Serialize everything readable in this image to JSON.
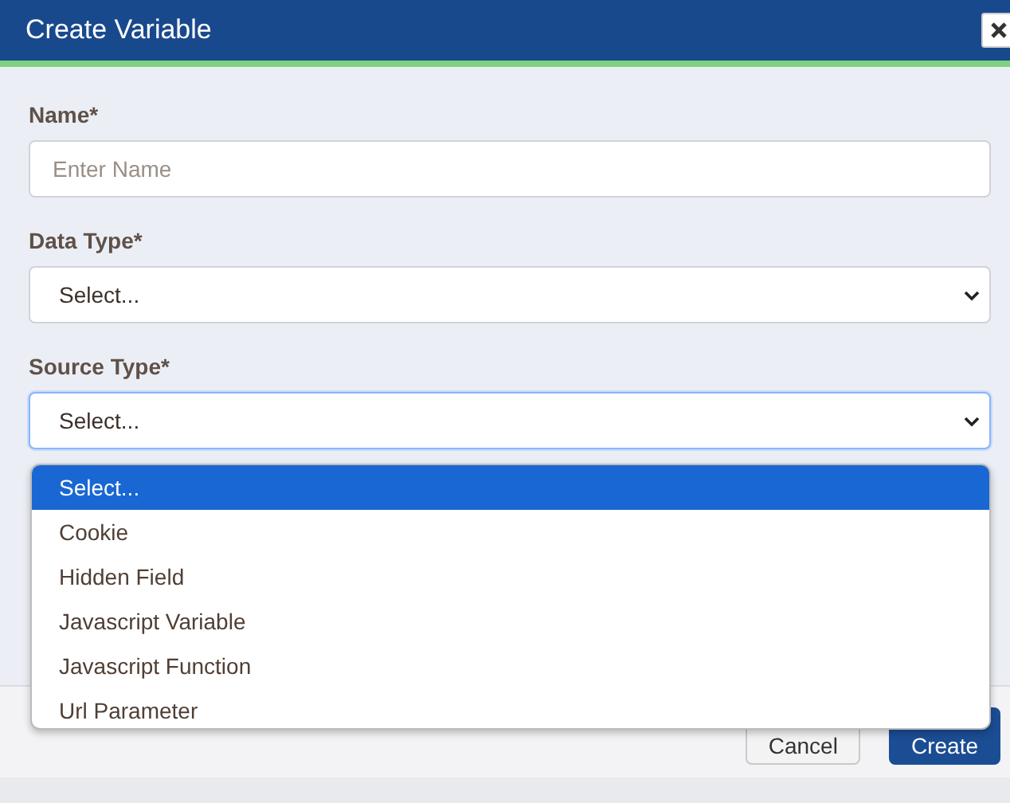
{
  "dialog": {
    "title": "Create Variable"
  },
  "fields": [
    {
      "label": "Name*",
      "kind": "text",
      "placeholder": "Enter Name",
      "focused": false
    },
    {
      "label": "Data Type*",
      "kind": "select",
      "value": "Select...",
      "focused": false
    },
    {
      "label": "Source Type*",
      "kind": "select",
      "value": "Select...",
      "focused": true
    }
  ],
  "dropdown": {
    "options": [
      {
        "label": "Select...",
        "selected": true
      },
      {
        "label": "Cookie",
        "selected": false
      },
      {
        "label": "Hidden Field",
        "selected": false
      },
      {
        "label": "Javascript Variable",
        "selected": false
      },
      {
        "label": "Javascript Function",
        "selected": false
      },
      {
        "label": "Url Parameter",
        "selected": false
      }
    ]
  },
  "buttons": [
    {
      "label": "Cancel",
      "kind": "secondary"
    },
    {
      "label": "Create",
      "kind": "primary"
    }
  ]
}
